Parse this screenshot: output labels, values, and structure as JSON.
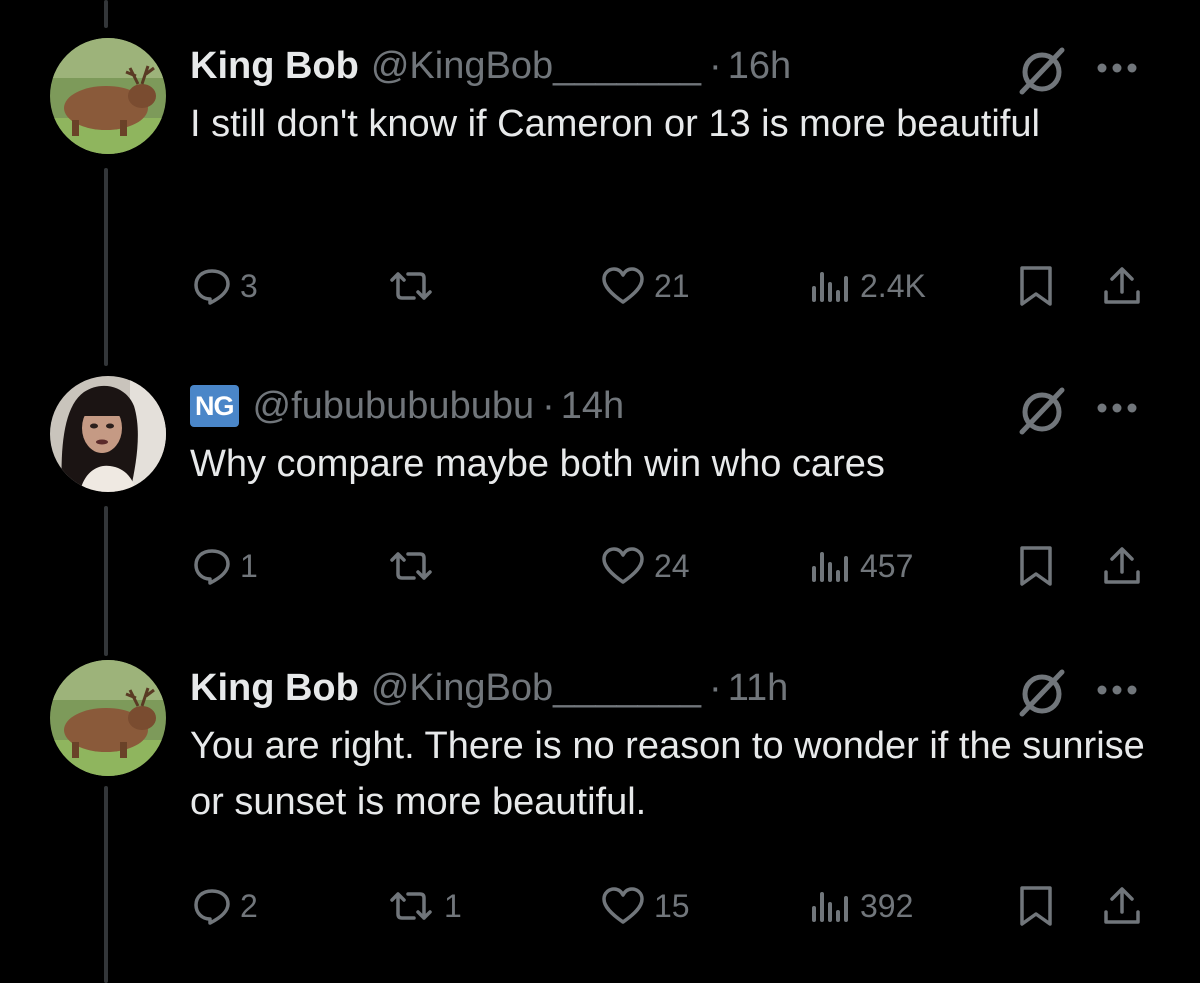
{
  "colors": {
    "background": "#000000",
    "text": "#e7e9ea",
    "muted": "#71767b",
    "badge": "#4a86c8",
    "thread_line": "#333639"
  },
  "tweets": [
    {
      "name": "King Bob",
      "handle": "@KingBob_______",
      "time": "16h",
      "text": "I still don't know if Cameron or 13 is more beautiful",
      "avatar": "capybara-avatar",
      "stats": {
        "replies": "3",
        "reposts": "",
        "likes": "21",
        "views": "2.4K"
      }
    },
    {
      "badge": "NG",
      "handle": "@fubububububu",
      "time": "14h",
      "text": "Why compare maybe both win who cares",
      "avatar": "person-avatar",
      "stats": {
        "replies": "1",
        "reposts": "",
        "likes": "24",
        "views": "457"
      }
    },
    {
      "name": "King Bob",
      "handle": "@KingBob_______",
      "time": "11h",
      "text": "You are right. There is no reason to wonder if the sunrise or sunset is more beautiful.",
      "avatar": "capybara-avatar",
      "stats": {
        "replies": "2",
        "reposts": "1",
        "likes": "15",
        "views": "392"
      }
    }
  ],
  "separator": "·"
}
